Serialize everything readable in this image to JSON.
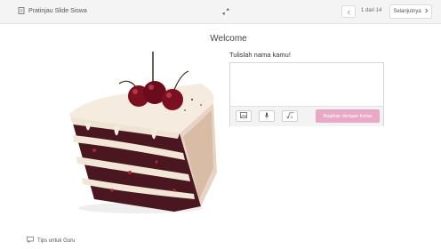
{
  "topbar": {
    "title": "Pratinjau Slide Siswa",
    "page_counter": "1 dari 14",
    "next_label": "Selanjutnya"
  },
  "slide": {
    "title": "Welcome",
    "prompt": "Tulislah nama kamu!",
    "answer_value": "",
    "share_label": "Bagikan dengan Kelas"
  },
  "footer": {
    "tips_label": "Tips untuk Guru"
  },
  "icons": {
    "slides": "slides-icon",
    "expand": "expand-icon",
    "prev": "chevron-left-icon",
    "next": "chevron-right-icon",
    "image": "image-icon",
    "mic": "microphone-icon",
    "math": "math-icon",
    "tips": "chat-icon"
  },
  "colors": {
    "share_button": "#e8a9c6",
    "cake_sponge": "#4a1620",
    "cherry": "#7a1020",
    "cream": "#f2e6d6"
  }
}
